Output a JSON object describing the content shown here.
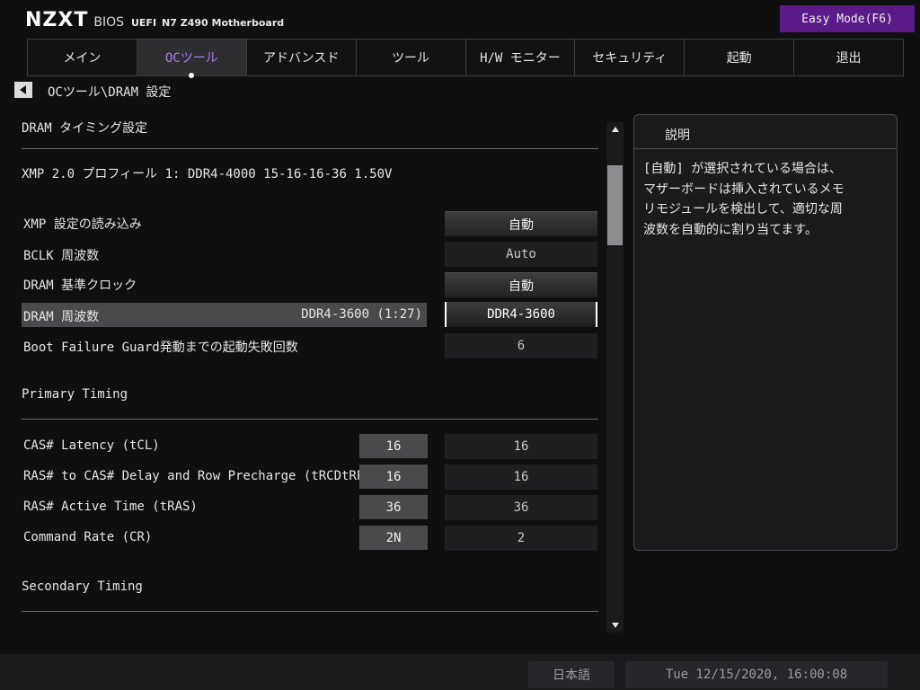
{
  "header": {
    "logo": "NZXT",
    "bios": "BIOS",
    "uefi": "UEFI",
    "board": "N7 Z490 Motherboard",
    "easy_mode": "Easy Mode(F6)",
    "accent_color": "#5a1a87",
    "active_tab_color": "#b07cf0"
  },
  "tabs": [
    {
      "label": "メイン"
    },
    {
      "label": "OCツール"
    },
    {
      "label": "アドバンスド"
    },
    {
      "label": "ツール"
    },
    {
      "label": "H/W モニター"
    },
    {
      "label": "セキュリティ"
    },
    {
      "label": "起動"
    },
    {
      "label": "退出"
    }
  ],
  "active_tab": "OCツール",
  "breadcrumb": "OCツール\\DRAM 設定",
  "sections": {
    "dram_timing": "DRAM タイミング設定",
    "xmp_profile": "XMP 2.0 プロフィール 1: DDR4-4000 15-16-16-36 1.50V",
    "primary": "Primary Timing",
    "secondary": "Secondary Timing"
  },
  "settings": [
    {
      "label": "XMP 設定の読み込み",
      "value": "自動"
    },
    {
      "label": "BCLK 周波数",
      "value": "Auto"
    },
    {
      "label": "DRAM 基準クロック",
      "value": "自動"
    },
    {
      "label": "DRAM 周波数",
      "current": "DDR4-3600 (1:27)",
      "value": "DDR4-3600"
    },
    {
      "label": "Boot Failure Guard発動までの起動失敗回数",
      "value": "6"
    }
  ],
  "primary_timings": [
    {
      "label": "CAS# Latency (tCL)",
      "current": "16",
      "value": "16"
    },
    {
      "label": "RAS# to CAS# Delay and Row Precharge (tRCDtRP)",
      "current": "16",
      "value": "16"
    },
    {
      "label": "RAS# Active Time (tRAS)",
      "current": "36",
      "value": "36"
    },
    {
      "label": "Command Rate (CR)",
      "current": "2N",
      "value": "2"
    }
  ],
  "help": {
    "title": "説明",
    "text": "[自動] が選択されている場合は、\nマザーボードは挿入されているメモ\nリモジュールを検出して、適切な周\n波数を自動的に割り当てます。"
  },
  "footer": {
    "language": "日本語",
    "datetime": "Tue 12/15/2020, 16:00:08"
  }
}
